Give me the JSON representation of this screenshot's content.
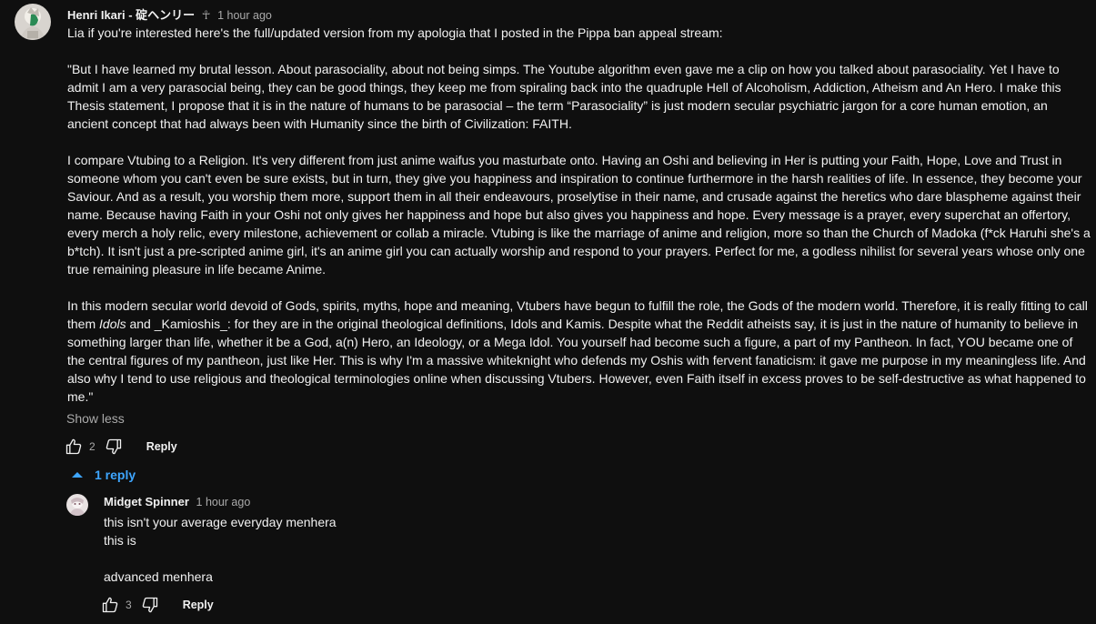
{
  "comment": {
    "author": "Henri Ikari - 碇ヘンリー",
    "pin_symbol": "☥",
    "time": "1 hour ago",
    "paragraphs": [
      "Lia if you're interested here's the full/updated version from my apologia that I posted in the Pippa ban appeal stream:",
      "\"But I have learned my brutal lesson. About parasociality, about not being simps. The Youtube algorithm even gave me a clip on how you talked about parasociality. Yet I have to admit I am a very parasocial being, they can be good things, they keep me from spiraling back into the quadruple Hell of Alcoholism, Addiction, Atheism and An Hero. I make this Thesis statement, I propose that it is in the nature of humans to be parasocial – the term “Parasociality” is just modern secular psychiatric jargon for a core human emotion, an ancient concept that had always been with Humanity since the birth of Civilization: FAITH.",
      "I compare Vtubing to a Religion. It's very different from just anime waifus you masturbate onto. Having an Oshi and believing in Her is putting your Faith, Hope, Love and Trust in someone whom you can't even be sure exists, but in turn, they give you happiness and inspiration to continue furthermore in the harsh realities of life. In essence, they become your Saviour. And as a result, you worship them more, support them in all their endeavours, proselytise in their name, and crusade against the heretics who dare blaspheme against their name. Because having Faith in your Oshi not only gives her happiness and hope but also gives you happiness and hope. Every message is a prayer, every superchat an offertory, every merch a holy relic, every milestone, achievement or collab a miracle. Vtubing is like the marriage of anime and religion, more so than the Church of Madoka (f*ck Haruhi she's a b*tch). It isn't just a pre-scripted anime girl, it's an anime girl you can actually worship and respond to your prayers. Perfect for me, a godless nihilist for several years whose only one true remaining pleasure in life became Anime."
    ],
    "para4_before": "In this modern secular world devoid of Gods, spirits, myths, hope and meaning, Vtubers have begun to fulfill the role, the Gods of the modern world. Therefore, it is really fitting to call them ",
    "para4_italic": "Idols",
    "para4_after": " and _Kamioshis_: for they are in the original theological definitions, Idols and Kamis. Despite what the Reddit atheists say, it is just in the nature of humanity to believe in something larger than life, whether it be a God, a(n) Hero, an Ideology, or a Mega Idol. You yourself had become such a figure, a part of my Pantheon. In fact, YOU became one of the central figures of my pantheon, just like Her. This is why I'm a massive whiteknight who defends my Oshis with fervent fanaticism: it gave me purpose in my meaningless life. And also why I tend to use religious and theological terminologies online when discussing Vtubers. However, even Faith itself in excess proves to be self-destructive as what happened to me.\"",
    "show_less": "Show less",
    "like_count": "2",
    "reply_label": "Reply"
  },
  "replies_toggle": {
    "label": "1 reply"
  },
  "reply": {
    "author": "Midget Spinner",
    "time": "1 hour ago",
    "lines": [
      "this isn't your average everyday menhera",
      "this is",
      "",
      "advanced menhera"
    ],
    "like_count": "3",
    "reply_label": "Reply"
  },
  "colors": {
    "background": "#0f0f0f",
    "text": "#f1f1f1",
    "secondary": "#aaaaaa",
    "link": "#3ea6ff"
  },
  "icons": [
    "like-icon",
    "dislike-icon",
    "caret-up-icon",
    "pin-icon"
  ]
}
